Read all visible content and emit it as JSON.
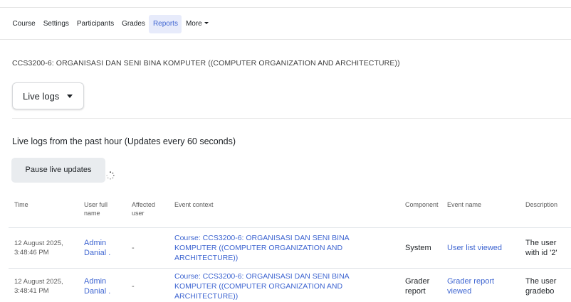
{
  "nav": {
    "items": [
      {
        "label": "Course"
      },
      {
        "label": "Settings"
      },
      {
        "label": "Participants"
      },
      {
        "label": "Grades"
      },
      {
        "label": "Reports",
        "active": true
      },
      {
        "label": "More"
      }
    ]
  },
  "course_title": "CCS3200-6: ORGANISASI DAN SENI BINA KOMPUTER ((COMPUTER ORGANIZATION AND ARCHITECTURE))",
  "report_select": {
    "value": "Live logs"
  },
  "live_heading": "Live logs from the past hour (Updates every 60 seconds)",
  "pause_button": "Pause live updates",
  "table": {
    "headers": {
      "time": "Time",
      "user_full_name_1": "User full",
      "user_full_name_2": "name",
      "affected_user_1": "Affected",
      "affected_user_2": "user",
      "event_context": "Event context",
      "component": "Component",
      "event_name": "Event name",
      "description": "Description"
    },
    "rows": [
      {
        "time_1": "12 August 2025,",
        "time_2": "3:48:46 PM",
        "user_1": "Admin",
        "user_2": "Danial .",
        "affected": "-",
        "context_1": "Course: CCS3200-6: ORGANISASI DAN SENI BINA",
        "context_2": "KOMPUTER ((COMPUTER ORGANIZATION AND",
        "context_3": "ARCHITECTURE))",
        "component_1": "System",
        "component_2": "",
        "event_1": "User list viewed",
        "event_2": "",
        "desc_1": "The user",
        "desc_2": "with id '2'"
      },
      {
        "time_1": "12 August 2025,",
        "time_2": "3:48:41 PM",
        "user_1": "Admin",
        "user_2": "Danial .",
        "affected": "-",
        "context_1": "Course: CCS3200-6: ORGANISASI DAN SENI BINA",
        "context_2": "KOMPUTER ((COMPUTER ORGANIZATION AND",
        "context_3": "ARCHITECTURE))",
        "component_1": "Grader",
        "component_2": "report",
        "event_1": "Grader report",
        "event_2": "viewed",
        "desc_1": "The user",
        "desc_2": "gradebo"
      }
    ]
  },
  "colors": {
    "accent": "#3e65d1",
    "active_tab_bg": "#e7ebfb",
    "button_bg": "#e9ecef"
  }
}
